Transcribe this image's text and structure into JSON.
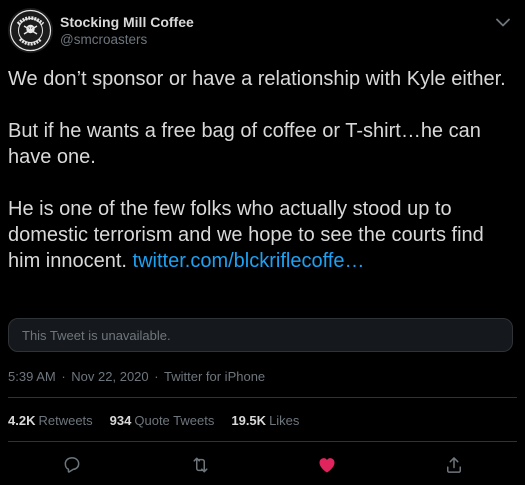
{
  "author": {
    "display_name": "Stocking Mill Coffee",
    "handle": "@smcroasters",
    "avatar_text_top": "STOCKING MILL",
    "avatar_text_bottom": "COFFEE"
  },
  "tweet": {
    "paragraphs": [
      "We don’t sponsor or have a relationship with Kyle either.",
      "But if he wants a free bag of coffee or T-shirt…he can have one."
    ],
    "last_paragraph_text": "He is one of the few folks who actually stood up to domestic terrorism and we hope to see the courts find him innocent.",
    "link_text": "twitter.com/blckriflecoffe…",
    "quoted_card_text": "This Tweet is unavailable."
  },
  "meta": {
    "time": "5:39 AM",
    "date": "Nov 22, 2020",
    "separator": "·",
    "source": "Twitter for iPhone"
  },
  "stats": {
    "retweets_count": "4.2K",
    "retweets_label": "Retweets",
    "quotes_count": "934",
    "quotes_label": "Quote Tweets",
    "likes_count": "19.5K",
    "likes_label": "Likes"
  },
  "icons": {
    "reply": "reply-icon",
    "retweet": "retweet-icon",
    "like": "heart-icon",
    "share": "share-icon",
    "more": "chevron-down-icon"
  },
  "colors": {
    "background": "#000000",
    "text": "#d9d9d9",
    "muted": "#6e767d",
    "link": "#1da1f2",
    "liked": "#e0245e",
    "border": "#2f3336"
  }
}
